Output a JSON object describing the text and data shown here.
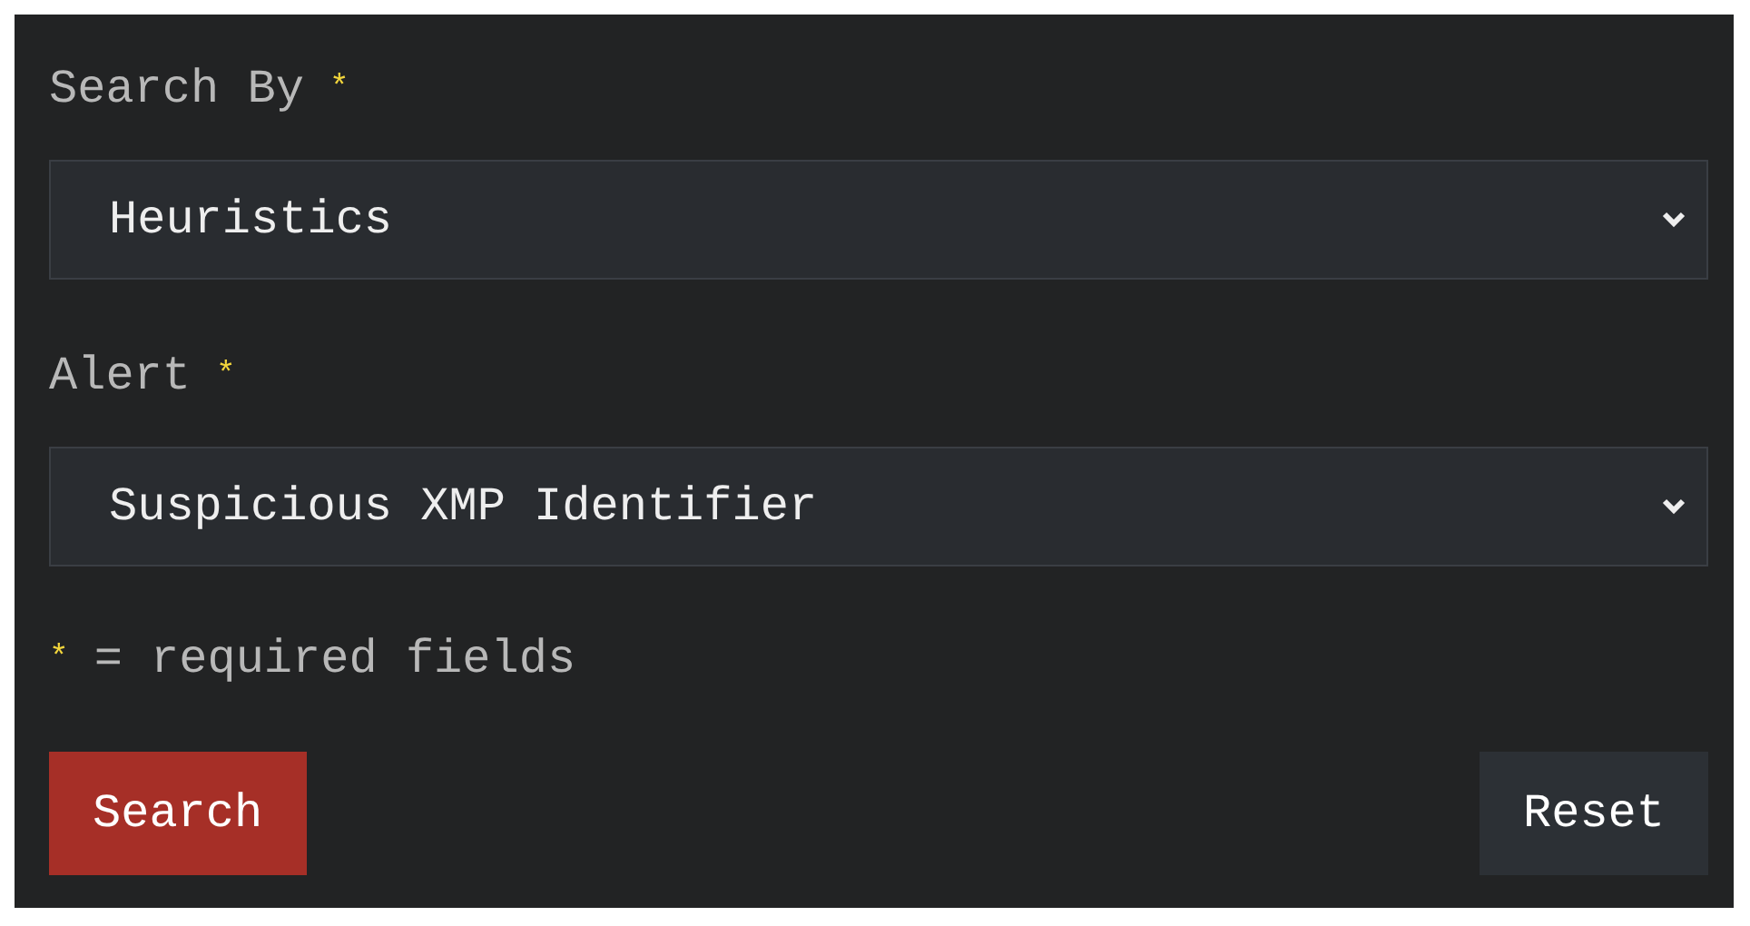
{
  "fields": [
    {
      "label": "Search By",
      "required_mark": "*",
      "value": "Heuristics"
    },
    {
      "label": "Alert",
      "required_mark": "*",
      "value": "Suspicious XMP Identifier"
    }
  ],
  "note": {
    "mark": "*",
    "text": "= required fields"
  },
  "buttons": [
    {
      "label": "Search",
      "kind": "primary"
    },
    {
      "label": "Reset",
      "kind": "secondary"
    }
  ]
}
